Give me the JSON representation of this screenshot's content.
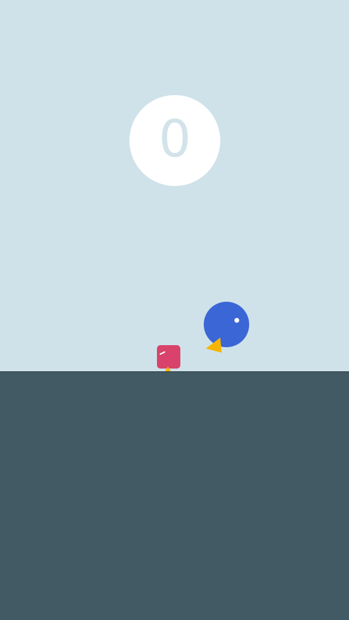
{
  "game": {
    "score": "0",
    "colors": {
      "sky": "#cfe2ea",
      "ground": "#425a64",
      "score_bubble": "#ffffff",
      "score_text": "#d2e3ea",
      "player": "#3b66d6",
      "player_beak": "#f7b500",
      "enemy": "#d9436b",
      "enemy_beak": "#f7b500"
    },
    "characters": {
      "player": "blue-ball-bird",
      "enemy": "pink-square-bird"
    }
  }
}
